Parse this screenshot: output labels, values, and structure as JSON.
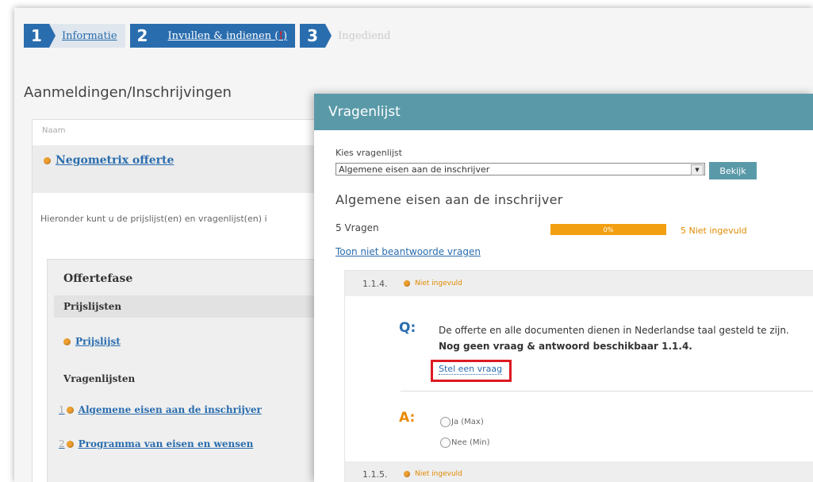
{
  "steps": [
    {
      "number": "1",
      "label": "Informatie"
    },
    {
      "number": "2",
      "label": "Invullen & indienen (",
      "error_count": "!",
      "suffix": ")"
    },
    {
      "number": "3",
      "label": "Ingediend"
    }
  ],
  "page": {
    "heading": "Aanmeldingen/Inschrijvingen",
    "column_header": "Naam",
    "offer_title": "Negometrix offerte",
    "description": "Hieronder kunt u de prijslijst(en) en vragenlijst(en) i",
    "phase_title": "Offertefase",
    "pricelists_header": "Prijslijsten",
    "pricelist_item": "Prijslijst",
    "questionnaires_header": "Vragenlijsten",
    "questionnaires": [
      {
        "number": "1",
        "label": "Algemene eisen aan de inschrijver"
      },
      {
        "number": "2",
        "label": "Programma van eisen en wensen"
      }
    ]
  },
  "modal": {
    "title": "Vragenlijst",
    "select_label": "Kies vragenlijst",
    "select_value": "Algemene eisen aan de inschrijver",
    "view_button": "Bekijk",
    "questionnaire_title": "Algemene eisen aan de inschrijver",
    "question_count": "5 Vragen",
    "progress_text": "0%",
    "progress_value": 0,
    "not_filled_count": "5 Niet ingevuld",
    "show_unanswered": "Toon niet beantwoorde vragen",
    "questions": [
      {
        "number": "1.1.4.",
        "status": "Niet ingevuld",
        "q_letter": "Q:",
        "text": "De offerte en alle documenten dienen in Nederlandse taal gesteld te zijn.",
        "note": "Nog geen vraag & antwoord beschikbaar   1.1.4.",
        "ask_link": "Stel een vraag",
        "a_letter": "A:",
        "options": [
          "Ja (Max)",
          "Nee (Min)"
        ]
      },
      {
        "number": "1.1.5.",
        "status": "Niet ingevuld"
      }
    ]
  },
  "colors": {
    "step_blue": "#2a6dae",
    "modal_teal": "#5a9aa8",
    "progress_orange": "#f2a012",
    "highlight_red": "#dd1a22"
  }
}
